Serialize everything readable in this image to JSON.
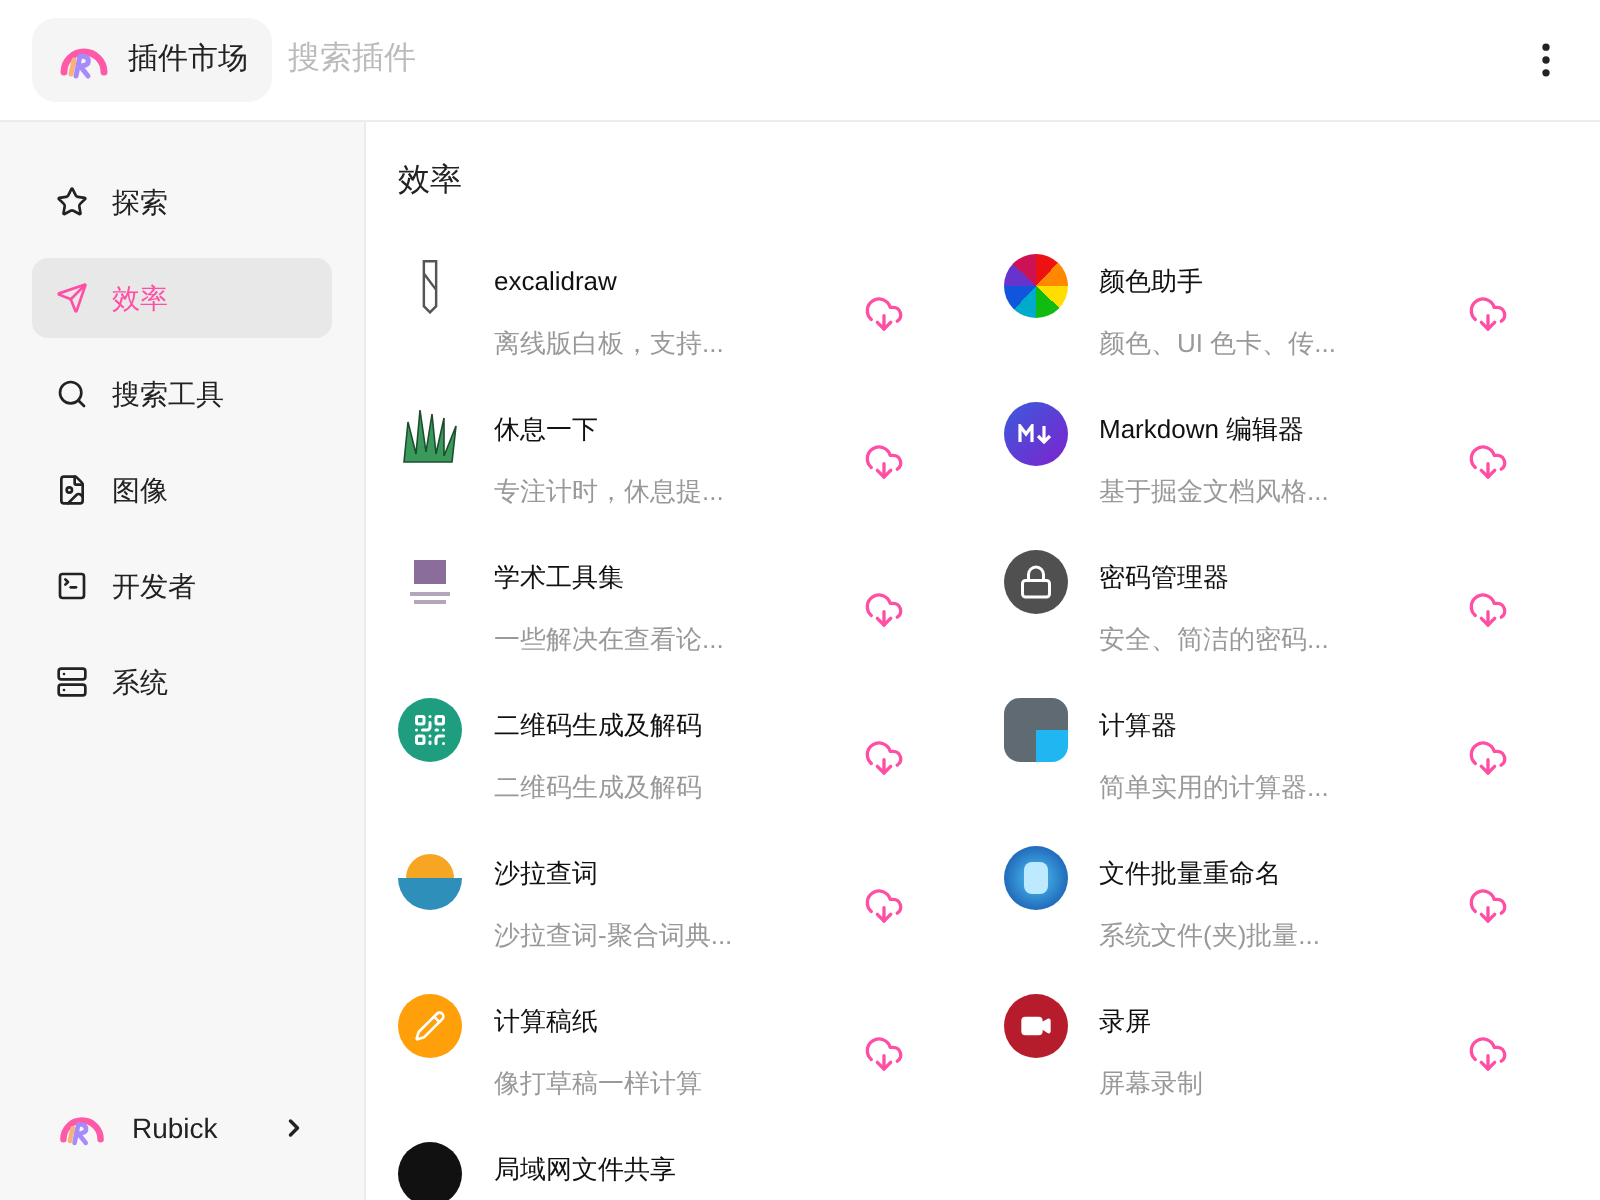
{
  "header": {
    "app_title": "插件市场",
    "search": {
      "placeholder": "搜索插件"
    }
  },
  "sidebar": {
    "items": [
      {
        "label": "探索",
        "selected": false
      },
      {
        "label": "效率",
        "selected": true
      },
      {
        "label": "搜索工具",
        "selected": false
      },
      {
        "label": "图像",
        "selected": false
      },
      {
        "label": "开发者",
        "selected": false
      },
      {
        "label": "系统",
        "selected": false
      }
    ],
    "footer": {
      "label": "Rubick"
    }
  },
  "section": {
    "title": "效率",
    "plugins": [
      {
        "name": "excalidraw",
        "description": "离线版白板，支持..."
      },
      {
        "name": "颜色助手",
        "description": "颜色、UI 色卡、传..."
      },
      {
        "name": "休息一下",
        "description": "专注计时，休息提..."
      },
      {
        "name": "Markdown 编辑器",
        "description": "基于掘金文档风格..."
      },
      {
        "name": "学术工具集",
        "description": "一些解决在查看论..."
      },
      {
        "name": "密码管理器",
        "description": "安全、简洁的密码..."
      },
      {
        "name": "二维码生成及解码",
        "description": "二维码生成及解码"
      },
      {
        "name": "计算器",
        "description": "简单实用的计算器..."
      },
      {
        "name": "沙拉查词",
        "description": "沙拉查词-聚合词典..."
      },
      {
        "name": "文件批量重命名",
        "description": "系统文件(夹)批量..."
      },
      {
        "name": "计算稿纸",
        "description": "像打草稿一样计算"
      },
      {
        "name": "录屏",
        "description": "屏幕录制"
      },
      {
        "name": "局域网文件共享"
      }
    ]
  }
}
